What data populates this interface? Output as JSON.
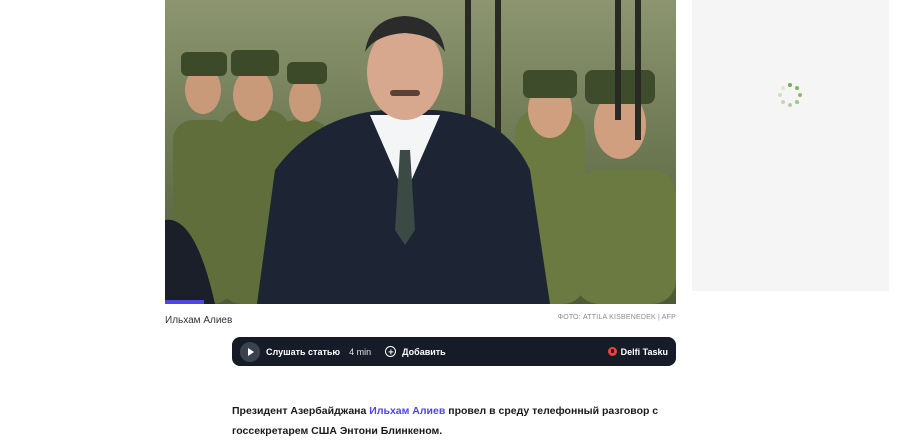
{
  "media": {
    "caption": "Ильхам Алиев",
    "credit": "ФОТО: ATTILA KISBENEDEK | AFP",
    "progress_fraction": 0.077,
    "accent_color": "#4f46e5"
  },
  "player": {
    "play_icon": "play-icon",
    "listen_label": "Слушать статью",
    "duration": "4 min",
    "add_icon": "plus-circle-icon",
    "add_label": "Добавить",
    "brand_icon": "delfi-logo-icon",
    "brand_label": "Delfi Tasku",
    "bg_color": "#151c27"
  },
  "sidebar": {
    "loading_icon": "loading-spinner-icon"
  },
  "article": {
    "intro_before": "Президент Азербайджана ",
    "intro_link": "Ильхам Алиев",
    "intro_after": " провел в среду телефонный разговор с госсекретарем США Энтони Блинкеном."
  }
}
